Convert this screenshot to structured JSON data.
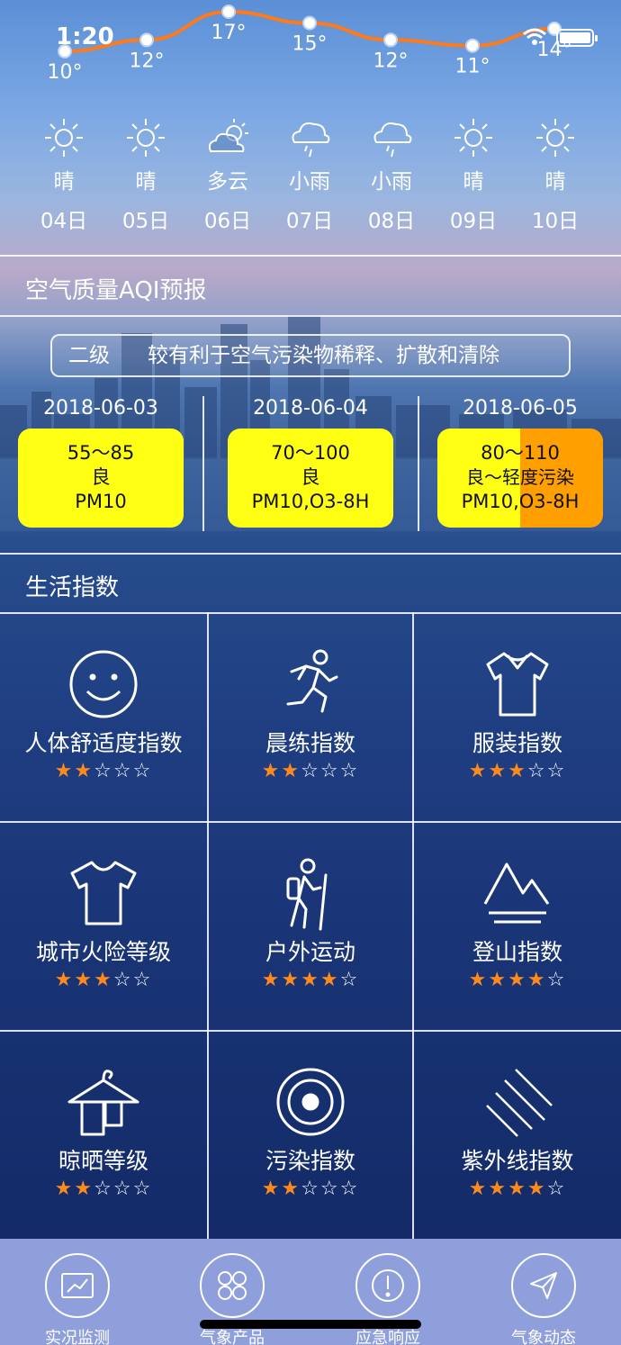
{
  "status_bar": {
    "time": "1:20"
  },
  "temperature_chart": {
    "highs": [
      "10°",
      "12°",
      "17°",
      "15°",
      "12°",
      "11°",
      "14°"
    ]
  },
  "forecast": [
    {
      "icon": "sun-icon",
      "condition": "晴",
      "date": "04日"
    },
    {
      "icon": "sun-icon",
      "condition": "晴",
      "date": "05日"
    },
    {
      "icon": "partly-cloudy-icon",
      "condition": "多云",
      "date": "06日"
    },
    {
      "icon": "light-rain-icon",
      "condition": "小雨",
      "date": "07日"
    },
    {
      "icon": "light-rain-icon",
      "condition": "小雨",
      "date": "08日"
    },
    {
      "icon": "sun-icon",
      "condition": "晴",
      "date": "09日"
    },
    {
      "icon": "sun-icon",
      "condition": "晴",
      "date": "10日"
    }
  ],
  "aqi": {
    "title": "空气质量AQI预报",
    "banner_level": "二级",
    "banner_text": "较有利于空气污染物稀释、扩散和清除",
    "days": [
      {
        "date": "2018-06-03",
        "range": "55～85",
        "quality": "良",
        "pollutant": "PM10",
        "colors": [
          "#ffff14"
        ]
      },
      {
        "date": "2018-06-04",
        "range": "70～100",
        "quality": "良",
        "pollutant": "PM10,O3-8H",
        "colors": [
          "#ffff14"
        ]
      },
      {
        "date": "2018-06-05",
        "range": "80～110",
        "quality": "良～轻度污染",
        "pollutant": "PM10,O3-8H",
        "colors": [
          "#ffff14",
          "#ff9f00"
        ]
      }
    ]
  },
  "life_index": {
    "title": "生活指数",
    "items": [
      {
        "icon": "smiley-icon",
        "name": "人体舒适度指数",
        "stars": 2
      },
      {
        "icon": "runner-icon",
        "name": "晨练指数",
        "stars": 2
      },
      {
        "icon": "shirt-icon",
        "name": "服装指数",
        "stars": 3
      },
      {
        "icon": "tshirt-icon",
        "name": "城市火险等级",
        "stars": 3
      },
      {
        "icon": "hiker-icon",
        "name": "户外运动",
        "stars": 4
      },
      {
        "icon": "mountain-icon",
        "name": "登山指数",
        "stars": 4
      },
      {
        "icon": "clothes-hanger-icon",
        "name": "晾晒等级",
        "stars": 2
      },
      {
        "icon": "target-icon",
        "name": "污染指数",
        "stars": 2
      },
      {
        "icon": "uv-rays-icon",
        "name": "紫外线指数",
        "stars": 4
      }
    ],
    "max_stars": 5
  },
  "tabbar": {
    "items": [
      {
        "icon": "line-chart-icon",
        "label": "实况监测"
      },
      {
        "icon": "grid-icon",
        "label": "气象产品"
      },
      {
        "icon": "alert-icon",
        "label": "应急响应"
      },
      {
        "icon": "paper-plane-icon",
        "label": "气象动态"
      }
    ]
  },
  "colors": {
    "star_on": "#ff8a1c",
    "curve": "#ff7a1a",
    "aqi_good": "#ffff14",
    "aqi_light": "#ff9f00",
    "tabbar": "#8f9fdc"
  }
}
